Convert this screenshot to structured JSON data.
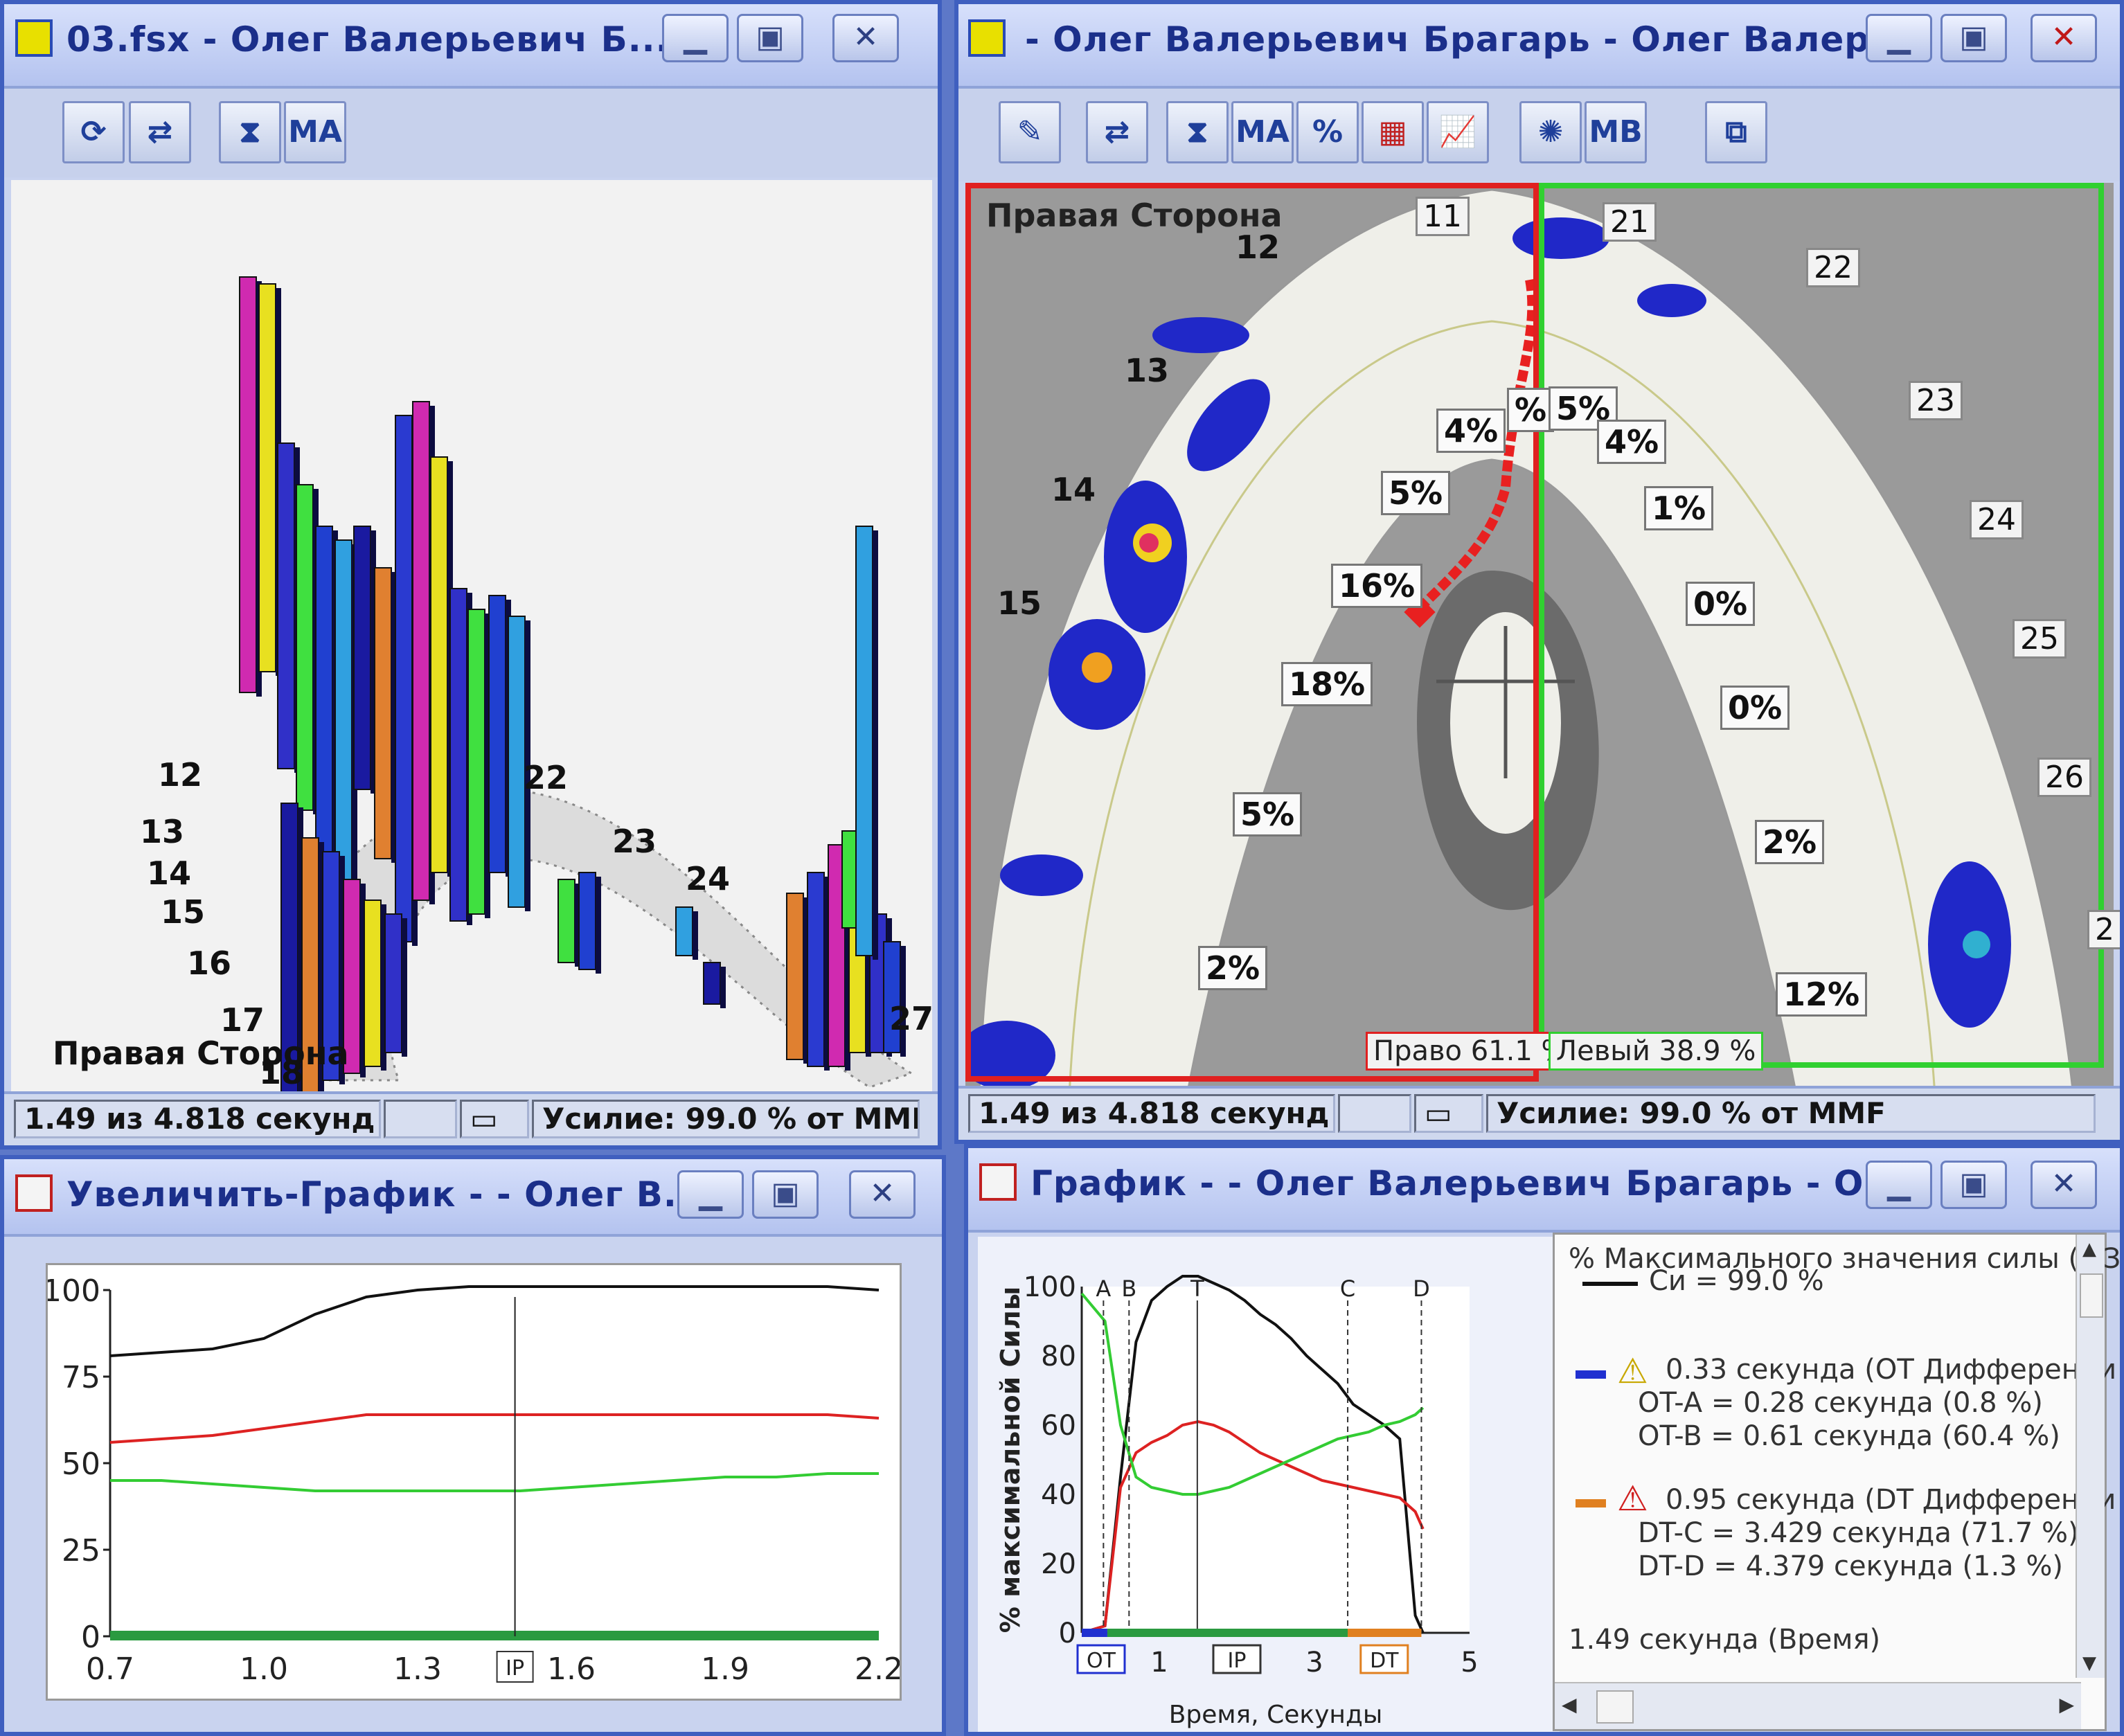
{
  "windows": {
    "w3d": {
      "title": "03.fsx - Олег Валерьевич Б...",
      "toolbar": {
        "ma_label": "MA"
      },
      "tooth_labels": [
        "12",
        "13",
        "14",
        "15",
        "16",
        "17",
        "18",
        "22",
        "23",
        "24",
        "27"
      ],
      "side_label": "Правая Сторона",
      "status_time": "1.49 из 4.818 секунд",
      "status_force": "Усилие: 99.0 % от MMF"
    },
    "wmap": {
      "title": "- Олег Валерьевич Брагарь - Олег Валер...",
      "toolbar": {
        "ma_label": "MA",
        "pct_label": "%",
        "mb_label": "МВ"
      },
      "side_label": "Правая Сторона",
      "tooth_numbers": [
        "11",
        "12",
        "13",
        "14",
        "15",
        "21",
        "22",
        "23",
        "24",
        "25",
        "26",
        "2"
      ],
      "right_percents": [
        "4%",
        "5%",
        "16%",
        "18%",
        "5%",
        "2%",
        "%"
      ],
      "left_percents": [
        "5%",
        "4%",
        "1%",
        "0%",
        "0%",
        "2%",
        "12%"
      ],
      "right_total": "Право 61.1 %",
      "left_total": "Левый 38.9 %",
      "status_time": "1.49 из 4.818 секунд",
      "status_force": "Усилие: 99.0 % от MMF"
    },
    "wzoom": {
      "title": "Увеличить-График - - Олег В...",
      "y_ticks": [
        "100",
        "75",
        "50",
        "25",
        "0"
      ],
      "x_ticks": [
        "0.7",
        "1.0",
        "1.3",
        "1.6",
        "1.9",
        "2.2"
      ],
      "ip_label": "IP"
    },
    "wgraph": {
      "title": "График - - Олег Валерьевич Брагарь - Ол...",
      "y_label": "% максимальной Силы",
      "x_label": "Время, Секунды",
      "y_ticks": [
        "100",
        "80",
        "60",
        "40",
        "20",
        "0"
      ],
      "x_ticks": [
        "1",
        "3",
        "5"
      ],
      "markers": [
        "A",
        "B",
        "T",
        "C",
        "D"
      ],
      "ot_label": "OT",
      "ip_label": "IP",
      "dt_label": "DT",
      "legend": {
        "header": "% Максимального значения силы (МЗ",
        "si": "Си = 99.0 %",
        "ot_line": "0.33 секунда (OT Дифференци",
        "ot_a": "OT-A = 0.28 секунда (0.8 %)",
        "ot_b": "OT-B = 0.61 секунда (60.4 %)",
        "dt_line": "0.95 секунда (DT Дифференци",
        "dt_c": "DT-C = 3.429 секунда (71.7 %)",
        "dt_d": "DT-D = 4.379 секунда (1.3 %)",
        "time": "1.49 секунда (Время)"
      }
    }
  },
  "chart_data": [
    {
      "type": "line",
      "title": "",
      "xlabel": "",
      "ylabel": "",
      "xlim": [
        0.7,
        2.2
      ],
      "ylim": [
        0,
        100
      ],
      "x": [
        0.7,
        0.8,
        0.9,
        1.0,
        1.1,
        1.2,
        1.3,
        1.4,
        1.5,
        1.6,
        1.7,
        1.8,
        1.9,
        2.0,
        2.1,
        2.2
      ],
      "series": [
        {
          "color": "#111111",
          "values": [
            81,
            82,
            83,
            86,
            93,
            98,
            100,
            101,
            101,
            101,
            101,
            101,
            101,
            101,
            101,
            100
          ]
        },
        {
          "color": "#dd2222",
          "values": [
            56,
            57,
            58,
            60,
            62,
            64,
            64,
            64,
            64,
            64,
            64,
            64,
            64,
            64,
            64,
            63
          ]
        },
        {
          "color": "#33cc33",
          "values": [
            45,
            45,
            44,
            43,
            42,
            42,
            42,
            42,
            42,
            43,
            44,
            45,
            46,
            46,
            47,
            47
          ]
        }
      ]
    },
    {
      "type": "line",
      "title": "",
      "xlabel": "Время, Секунды",
      "ylabel": "% максимальной Силы",
      "xlim": [
        0,
        5
      ],
      "ylim": [
        0,
        100
      ],
      "x": [
        0.0,
        0.3,
        0.5,
        0.7,
        0.9,
        1.1,
        1.3,
        1.5,
        1.7,
        1.9,
        2.1,
        2.3,
        2.5,
        2.7,
        2.9,
        3.1,
        3.3,
        3.5,
        3.7,
        3.9,
        4.1,
        4.3,
        4.4
      ],
      "series": [
        {
          "color": "#111111",
          "values": [
            0,
            2,
            45,
            84,
            96,
            100,
            103,
            103,
            101,
            99,
            96,
            92,
            89,
            85,
            80,
            76,
            72,
            66,
            63,
            60,
            56,
            5,
            0
          ]
        },
        {
          "color": "#dd2222",
          "values": [
            0,
            2,
            42,
            52,
            55,
            57,
            60,
            61,
            60,
            58,
            55,
            52,
            50,
            48,
            46,
            44,
            43,
            42,
            41,
            40,
            39,
            35,
            30
          ]
        },
        {
          "color": "#33cc33",
          "values": [
            98,
            90,
            60,
            45,
            42,
            41,
            40,
            40,
            41,
            42,
            44,
            46,
            48,
            50,
            52,
            54,
            56,
            57,
            58,
            60,
            61,
            63,
            65
          ]
        }
      ]
    }
  ]
}
